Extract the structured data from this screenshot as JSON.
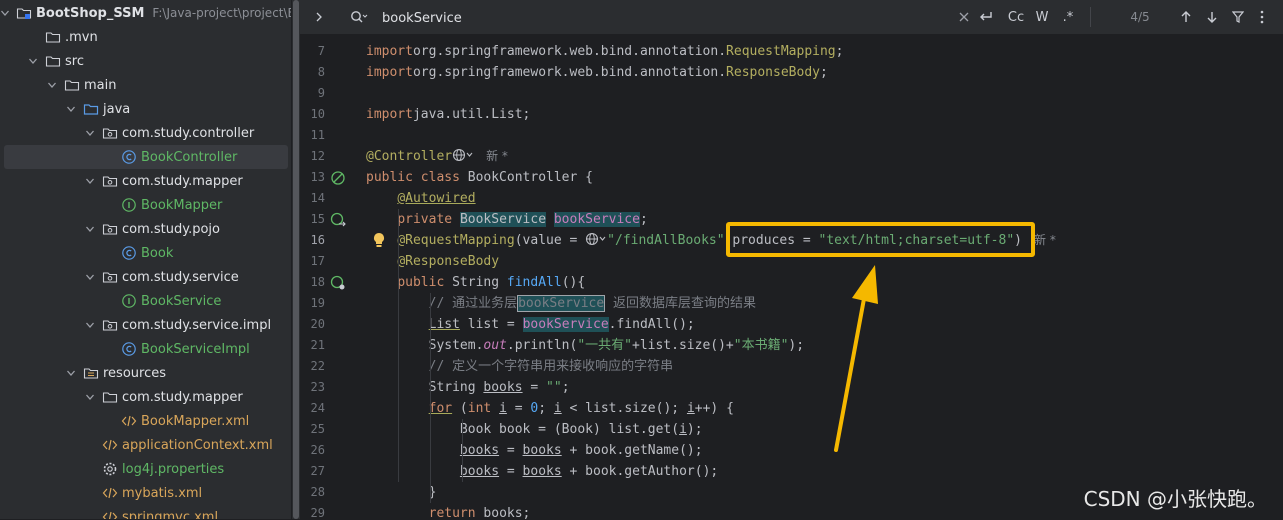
{
  "project": {
    "name": "BootShop_SSM",
    "path": "F:\\Java-project\\project\\Boo",
    "tree": [
      {
        "label": "BootShop_SSM",
        "depth": 0,
        "chevron": "down",
        "icon": "module-folder-icon",
        "kind": "root"
      },
      {
        "label": ".mvn",
        "depth": 1,
        "chevron": "",
        "icon": "folder-icon",
        "kind": "folder"
      },
      {
        "label": "src",
        "depth": 1,
        "chevron": "down",
        "icon": "folder-icon",
        "kind": "folder"
      },
      {
        "label": "main",
        "depth": 2,
        "chevron": "down",
        "icon": "folder-icon",
        "kind": "folder"
      },
      {
        "label": "java",
        "depth": 3,
        "chevron": "down",
        "icon": "source-folder-icon",
        "kind": "folder"
      },
      {
        "label": "com.study.controller",
        "depth": 4,
        "chevron": "down",
        "icon": "package-icon",
        "kind": "package"
      },
      {
        "label": "BookController",
        "depth": 5,
        "chevron": "",
        "icon": "class-icon",
        "kind": "class",
        "selected": true
      },
      {
        "label": "com.study.mapper",
        "depth": 4,
        "chevron": "down",
        "icon": "package-icon",
        "kind": "package"
      },
      {
        "label": "BookMapper",
        "depth": 5,
        "chevron": "",
        "icon": "interface-icon",
        "kind": "interface"
      },
      {
        "label": "com.study.pojo",
        "depth": 4,
        "chevron": "down",
        "icon": "package-icon",
        "kind": "package"
      },
      {
        "label": "Book",
        "depth": 5,
        "chevron": "",
        "icon": "class-icon",
        "kind": "class"
      },
      {
        "label": "com.study.service",
        "depth": 4,
        "chevron": "down",
        "icon": "package-icon",
        "kind": "package"
      },
      {
        "label": "BookService",
        "depth": 5,
        "chevron": "",
        "icon": "interface-icon",
        "kind": "interface"
      },
      {
        "label": "com.study.service.impl",
        "depth": 4,
        "chevron": "down",
        "icon": "package-icon",
        "kind": "package"
      },
      {
        "label": "BookServiceImpl",
        "depth": 5,
        "chevron": "",
        "icon": "class-icon",
        "kind": "class"
      },
      {
        "label": "resources",
        "depth": 3,
        "chevron": "down",
        "icon": "resources-folder-icon",
        "kind": "folder"
      },
      {
        "label": "com.study.mapper",
        "depth": 4,
        "chevron": "down",
        "icon": "folder-icon",
        "kind": "package"
      },
      {
        "label": "BookMapper.xml",
        "depth": 5,
        "chevron": "",
        "icon": "xml-file-icon",
        "kind": "xml"
      },
      {
        "label": "applicationContext.xml",
        "depth": 4,
        "chevron": "",
        "icon": "xml-file-icon",
        "kind": "xml"
      },
      {
        "label": "log4j.properties",
        "depth": 4,
        "chevron": "",
        "icon": "properties-file-icon",
        "kind": "props"
      },
      {
        "label": "mybatis.xml",
        "depth": 4,
        "chevron": "",
        "icon": "xml-file-icon",
        "kind": "xml"
      },
      {
        "label": "springmvc.xml",
        "depth": 4,
        "chevron": "",
        "icon": "xml-file-icon",
        "kind": "xml"
      }
    ]
  },
  "search": {
    "query": "bookService",
    "match_count": "4/5",
    "case_label": "Cc",
    "word_label": "W",
    "regex_label": ".*"
  },
  "editor": {
    "current_line": "16",
    "lines": [
      {
        "n": "7",
        "tokens": [
          [
            "kw",
            "import"
          ],
          [
            "",
            "org.springframework.web.bind.annotation."
          ],
          [
            "ann",
            "RequestMapping"
          ],
          [
            "",
            ";"
          ]
        ]
      },
      {
        "n": "8",
        "tokens": [
          [
            "kw",
            "import"
          ],
          [
            "",
            "org.springframework.web.bind.annotation."
          ],
          [
            "ann",
            "ResponseBody"
          ],
          [
            "",
            ";"
          ]
        ]
      },
      {
        "n": "9",
        "tokens": []
      },
      {
        "n": "10",
        "tokens": [
          [
            "kw",
            "import"
          ],
          [
            "",
            "java.util.List;"
          ]
        ]
      },
      {
        "n": "11",
        "tokens": []
      },
      {
        "n": "12",
        "tokens": [
          [
            "ann",
            "@Controller"
          ],
          [
            "globe",
            ""
          ],
          [
            "hint",
            "新 *"
          ]
        ]
      },
      {
        "n": "13",
        "tokens": [
          [
            "kw",
            "public class "
          ],
          [
            "",
            "BookController {"
          ]
        ]
      },
      {
        "n": "14",
        "tokens": [
          [
            "",
            "    "
          ],
          [
            "ann uline",
            "@Autowired"
          ]
        ]
      },
      {
        "n": "15",
        "tokens": [
          [
            "",
            "    "
          ],
          [
            "kw",
            "private "
          ],
          [
            "hl",
            "BookService"
          ],
          [
            "",
            " "
          ],
          [
            "fld hl",
            "bookService"
          ],
          [
            "",
            ";"
          ]
        ]
      },
      {
        "n": "16",
        "tokens": [
          [
            "",
            "    "
          ],
          [
            "ann",
            "@RequestMapping"
          ],
          [
            "",
            "(value = "
          ],
          [
            "globe",
            ""
          ],
          [
            "str",
            "\"/findAllBooks\""
          ],
          [
            "",
            ",produces = "
          ],
          [
            "str",
            "\"text/html;charset=utf-8\""
          ],
          [
            "",
            ")"
          ],
          [
            "hint",
            "新 *"
          ]
        ]
      },
      {
        "n": "17",
        "tokens": [
          [
            "",
            "    "
          ],
          [
            "ann",
            "@ResponseBody"
          ]
        ]
      },
      {
        "n": "18",
        "tokens": [
          [
            "",
            "    "
          ],
          [
            "kw",
            "public "
          ],
          [
            "",
            "String "
          ],
          [
            "fn",
            "findAll"
          ],
          [
            "",
            "(){"
          ]
        ]
      },
      {
        "n": "19",
        "tokens": [
          [
            "",
            "        "
          ],
          [
            "cmt",
            "// 通过业务层"
          ],
          [
            "cmt hlbox",
            "bookService"
          ],
          [
            "cmt",
            " 返回数据库层查询的结果"
          ]
        ]
      },
      {
        "n": "20",
        "tokens": [
          [
            "",
            "        "
          ],
          [
            "uline",
            "List"
          ],
          [
            "",
            " list = "
          ],
          [
            "fld hl",
            "bookService"
          ],
          [
            "",
            ".findAll();"
          ]
        ]
      },
      {
        "n": "21",
        "tokens": [
          [
            "",
            "        System."
          ],
          [
            "fld ital",
            "out"
          ],
          [
            "",
            ".println("
          ],
          [
            "str",
            "\"一共有\""
          ],
          [
            "",
            "+list.size()+"
          ],
          [
            "str",
            "\"本书籍\""
          ],
          [
            "",
            ");"
          ]
        ]
      },
      {
        "n": "22",
        "tokens": [
          [
            "",
            "        "
          ],
          [
            "cmt",
            "// 定义一个字符串用来接收响应的字符串"
          ]
        ]
      },
      {
        "n": "23",
        "tokens": [
          [
            "",
            "        String "
          ],
          [
            "uref",
            "books"
          ],
          [
            "",
            " = "
          ],
          [
            "str",
            "\"\""
          ],
          [
            "",
            ";"
          ]
        ]
      },
      {
        "n": "24",
        "tokens": [
          [
            "",
            "        "
          ],
          [
            "kw uline",
            "for"
          ],
          [
            "",
            " ("
          ],
          [
            "kw",
            "int "
          ],
          [
            "uref",
            "i"
          ],
          [
            "",
            " = "
          ],
          [
            "fn",
            "0"
          ],
          [
            "",
            "; "
          ],
          [
            "uref",
            "i"
          ],
          [
            "",
            " < list.size(); "
          ],
          [
            "uref",
            "i"
          ],
          [
            "",
            "++) {"
          ]
        ]
      },
      {
        "n": "25",
        "tokens": [
          [
            "",
            "            Book book = (Book) list.get("
          ],
          [
            "uref",
            "i"
          ],
          [
            "",
            ");"
          ]
        ]
      },
      {
        "n": "26",
        "tokens": [
          [
            "",
            "            "
          ],
          [
            "uref",
            "books"
          ],
          [
            "",
            " = "
          ],
          [
            "uref",
            "books"
          ],
          [
            "",
            " + book.getName();"
          ]
        ]
      },
      {
        "n": "27",
        "tokens": [
          [
            "",
            "            "
          ],
          [
            "uref",
            "books"
          ],
          [
            "",
            " = "
          ],
          [
            "uref",
            "books"
          ],
          [
            "",
            " + book.getAuthor();"
          ]
        ]
      },
      {
        "n": "28",
        "tokens": [
          [
            "",
            "        }"
          ]
        ]
      },
      {
        "n": "29",
        "tokens": [
          [
            "",
            "        "
          ],
          [
            "kw",
            "return "
          ],
          [
            "",
            "books;"
          ]
        ]
      }
    ]
  },
  "watermark": "CSDN @小张快跑。",
  "colors": {
    "callout": "#f5b800",
    "keyword": "#cf8e6d",
    "annotation": "#b3ae60",
    "string": "#6aab73"
  }
}
